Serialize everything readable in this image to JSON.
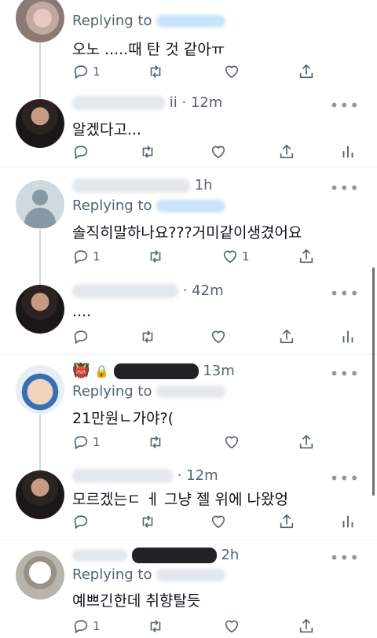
{
  "tweets": [
    {
      "time": "",
      "replying": "Replying to",
      "text": "오노 .....때 탄 것 같아ㅠ",
      "reply_count": "1",
      "like_count": ""
    },
    {
      "time": "ii · 12m",
      "replying": "",
      "text": "알겠다고...",
      "reply_count": "",
      "like_count": ""
    },
    {
      "time": "1h",
      "replying": "Replying to",
      "text": "솔직히말하나요???거미같이생겼어요",
      "reply_count": "1",
      "like_count": "1"
    },
    {
      "time": "· 42m",
      "replying": "",
      "text": "....",
      "reply_count": "",
      "like_count": ""
    },
    {
      "time": "13m",
      "replying": "Replying to",
      "text": "21만원ㄴ가야?(",
      "reply_count": "1",
      "like_count": ""
    },
    {
      "time": "· 12m",
      "replying": "",
      "text": "모르겠는ㄷ ㅔ 그냥 젤 위에 나왔엉",
      "reply_count": "",
      "like_count": ""
    },
    {
      "time": "2h",
      "replying": "Replying to",
      "text": "예쁘긴한데 취향탈듯",
      "reply_count": "1",
      "like_count": ""
    }
  ],
  "more_glyph": "•••",
  "badge_emoji": "👹",
  "lock_glyph": "🔒"
}
